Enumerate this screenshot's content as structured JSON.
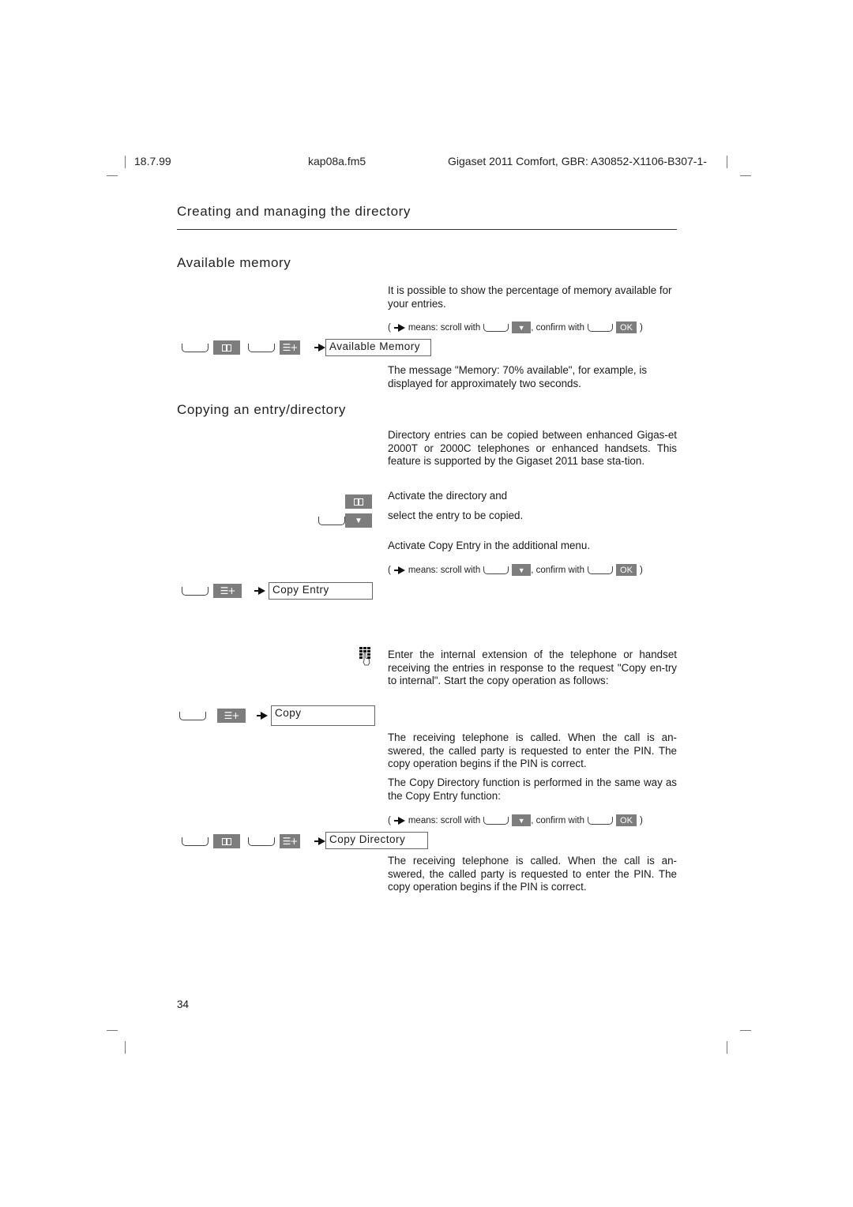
{
  "header": {
    "date": "18.7.99",
    "filename": "kap08a.fm5",
    "product": "Gigaset 2011 Comfort, GBR: A30852-X1106-B307-1-"
  },
  "chapter_title": "Creating and managing the directory",
  "sections": {
    "available_memory": {
      "title": "Available memory",
      "intro": "It is possible to show the percentage of memory available for your entries.",
      "display_label": "Available Memory",
      "result": "The message \"Memory: 70% available\", for example, is displayed for approximately two seconds."
    },
    "copying": {
      "title": "Copying an entry/directory",
      "intro": "Directory entries can be copied between enhanced Gigas-et 2000T or 2000C telephones or enhanced handsets. This feature is supported by the Gigaset 2011 base sta-tion.",
      "step_activate": "Activate the directory and",
      "step_select": "select the entry to be copied.",
      "step_menu": "Activate Copy Entry in the additional menu.",
      "copy_entry_label": "Copy Entry",
      "enter_extension": "Enter the internal extension of the telephone or handset receiving the entries in response to the request \"Copy en-try to internal\". Start the copy operation as follows:",
      "copy_label": "Copy",
      "called_text_1": "The receiving telephone is called. When the call is an-swered, the called party is requested to enter the PIN. The copy operation begins if the PIN is correct.",
      "copy_dir_intro": "The Copy Directory function is performed in the same way as the Copy Entry function:",
      "copy_directory_label": "Copy Directory",
      "called_text_2": "The receiving telephone is called. When the call is an-swered, the called party is requested to enter the PIN. The copy operation begins if the PIN is correct."
    }
  },
  "hint": {
    "open": "(",
    "means": "means: scroll with",
    "confirm": ", confirm with",
    "ok": "OK",
    "close": ")"
  },
  "icons": {
    "book": "directory-book-icon",
    "menu": "menu-plus-icon",
    "down": "down-arrow-icon",
    "keypad": "keypad-icon",
    "arrow": "scroll-arrow-icon"
  },
  "page_number": "34",
  "colors": {
    "icon_gray": "#7d7d7d",
    "text": "#1a1a1a"
  }
}
